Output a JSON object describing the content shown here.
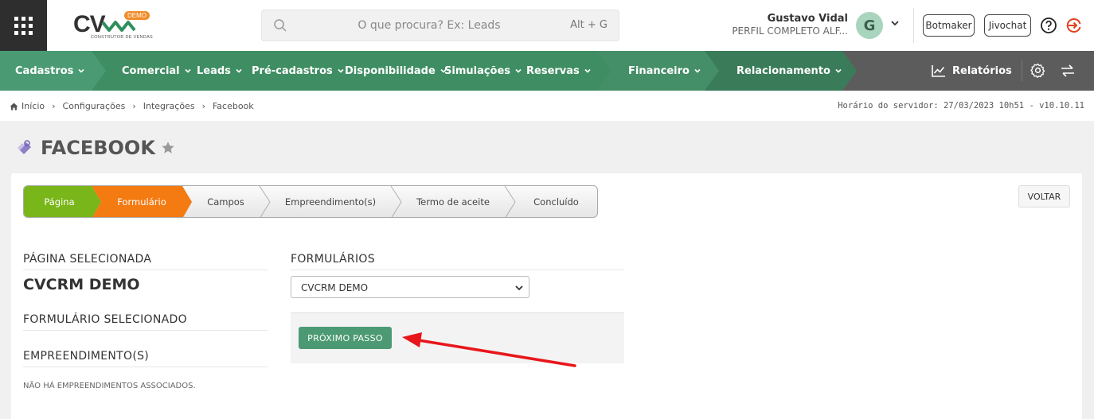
{
  "app": {
    "logo_text": "CV",
    "logo_badge": "DEMO",
    "logo_subtitle": "CONSTRUTOR DE VENDAS"
  },
  "search": {
    "placeholder": "O que procura? Ex: Leads",
    "shortcut": "Alt + G"
  },
  "user": {
    "name": "Gustavo Vidal",
    "profile": "PERFIL COMPLETO ALF...",
    "avatar_letter": "G"
  },
  "header_buttons": {
    "botmaker": "Botmaker",
    "jivochat": "Jivochat"
  },
  "nav": {
    "items": [
      {
        "label": "Cadastros"
      },
      {
        "label": "Comercial"
      },
      {
        "label": "Leads"
      },
      {
        "label": "Pré-cadastros"
      },
      {
        "label": "Disponibilidade"
      },
      {
        "label": "Simulações"
      },
      {
        "label": "Reservas"
      },
      {
        "label": "Financeiro"
      },
      {
        "label": "Relacionamento"
      }
    ],
    "reports_label": "Relatórios"
  },
  "breadcrumb": {
    "items": [
      "Início",
      "Configurações",
      "Integrações",
      "Facebook"
    ],
    "server_time": "Horário do servidor: 27/03/2023 10h51 - v10.10.11"
  },
  "page": {
    "title": "FACEBOOK"
  },
  "wizard": {
    "steps": [
      {
        "label": "Página",
        "state": "done"
      },
      {
        "label": "Formulário",
        "state": "current"
      },
      {
        "label": "Campos",
        "state": "pending"
      },
      {
        "label": "Empreendimento(s)",
        "state": "pending"
      },
      {
        "label": "Termo de aceite",
        "state": "pending"
      },
      {
        "label": "Concluído",
        "state": "pending"
      }
    ],
    "back_label": "VOLTAR"
  },
  "left_panel": {
    "selected_page_label": "PÁGINA SELECIONADA",
    "selected_page_value": "CVCRM DEMO",
    "selected_form_label": "FORMULÁRIO SELECIONADO",
    "developments_label": "EMPREENDIMENTO(S)",
    "developments_empty": "NÃO HÁ EMPREENDIMENTOS ASSOCIADOS."
  },
  "right_panel": {
    "forms_label": "FORMULÁRIOS",
    "forms_selected": "CVCRM DEMO",
    "next_button": "PRÓXIMO PASSO"
  },
  "colors": {
    "nav_green": "#3f8e63",
    "nav_gray": "#5c5c5c",
    "step_done": "#7cb518",
    "step_current": "#f47a12",
    "primary_button": "#4c9a73",
    "annotation_arrow": "#e8161b"
  },
  "icons": [
    "apps-grid-icon",
    "search-icon",
    "chevron-down-icon",
    "help-icon",
    "logout-icon",
    "chart-line-icon",
    "gear-icon",
    "swap-icon",
    "home-icon",
    "facebook-integration-icon",
    "star-icon"
  ]
}
